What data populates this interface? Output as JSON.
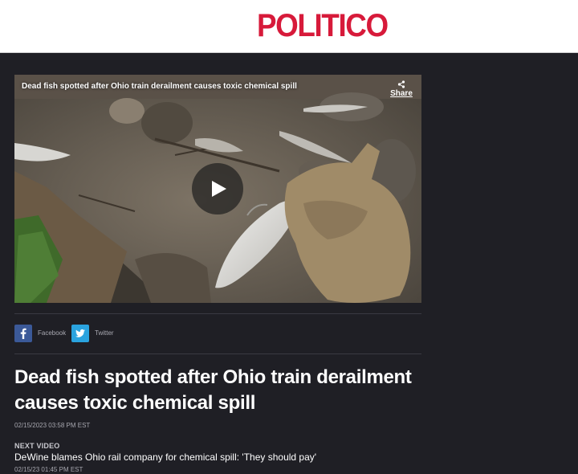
{
  "header": {
    "logo": "POLITICO"
  },
  "video": {
    "title": "Dead fish spotted after Ohio train derailment causes toxic chemical spill",
    "share_label": "Share",
    "icons": {
      "share": "share-icon",
      "play": "play-icon"
    }
  },
  "social": {
    "facebook_label": "Facebook",
    "twitter_label": "Twitter",
    "icons": {
      "facebook": "facebook-icon",
      "twitter": "twitter-icon"
    },
    "colors": {
      "facebook": "#3b5998",
      "twitter": "#2aa3df"
    }
  },
  "article": {
    "headline": "Dead fish spotted after Ohio train derailment causes toxic chemical spill",
    "date": "02/15/2023 03:58 PM EST"
  },
  "next_video": {
    "label": "NEXT VIDEO",
    "title": "DeWine blames Ohio rail company for chemical spill: 'They should pay'",
    "date": "02/15/23 01:45 PM EST"
  },
  "colors": {
    "brand": "#d71a3a",
    "background": "#1f1f25"
  }
}
